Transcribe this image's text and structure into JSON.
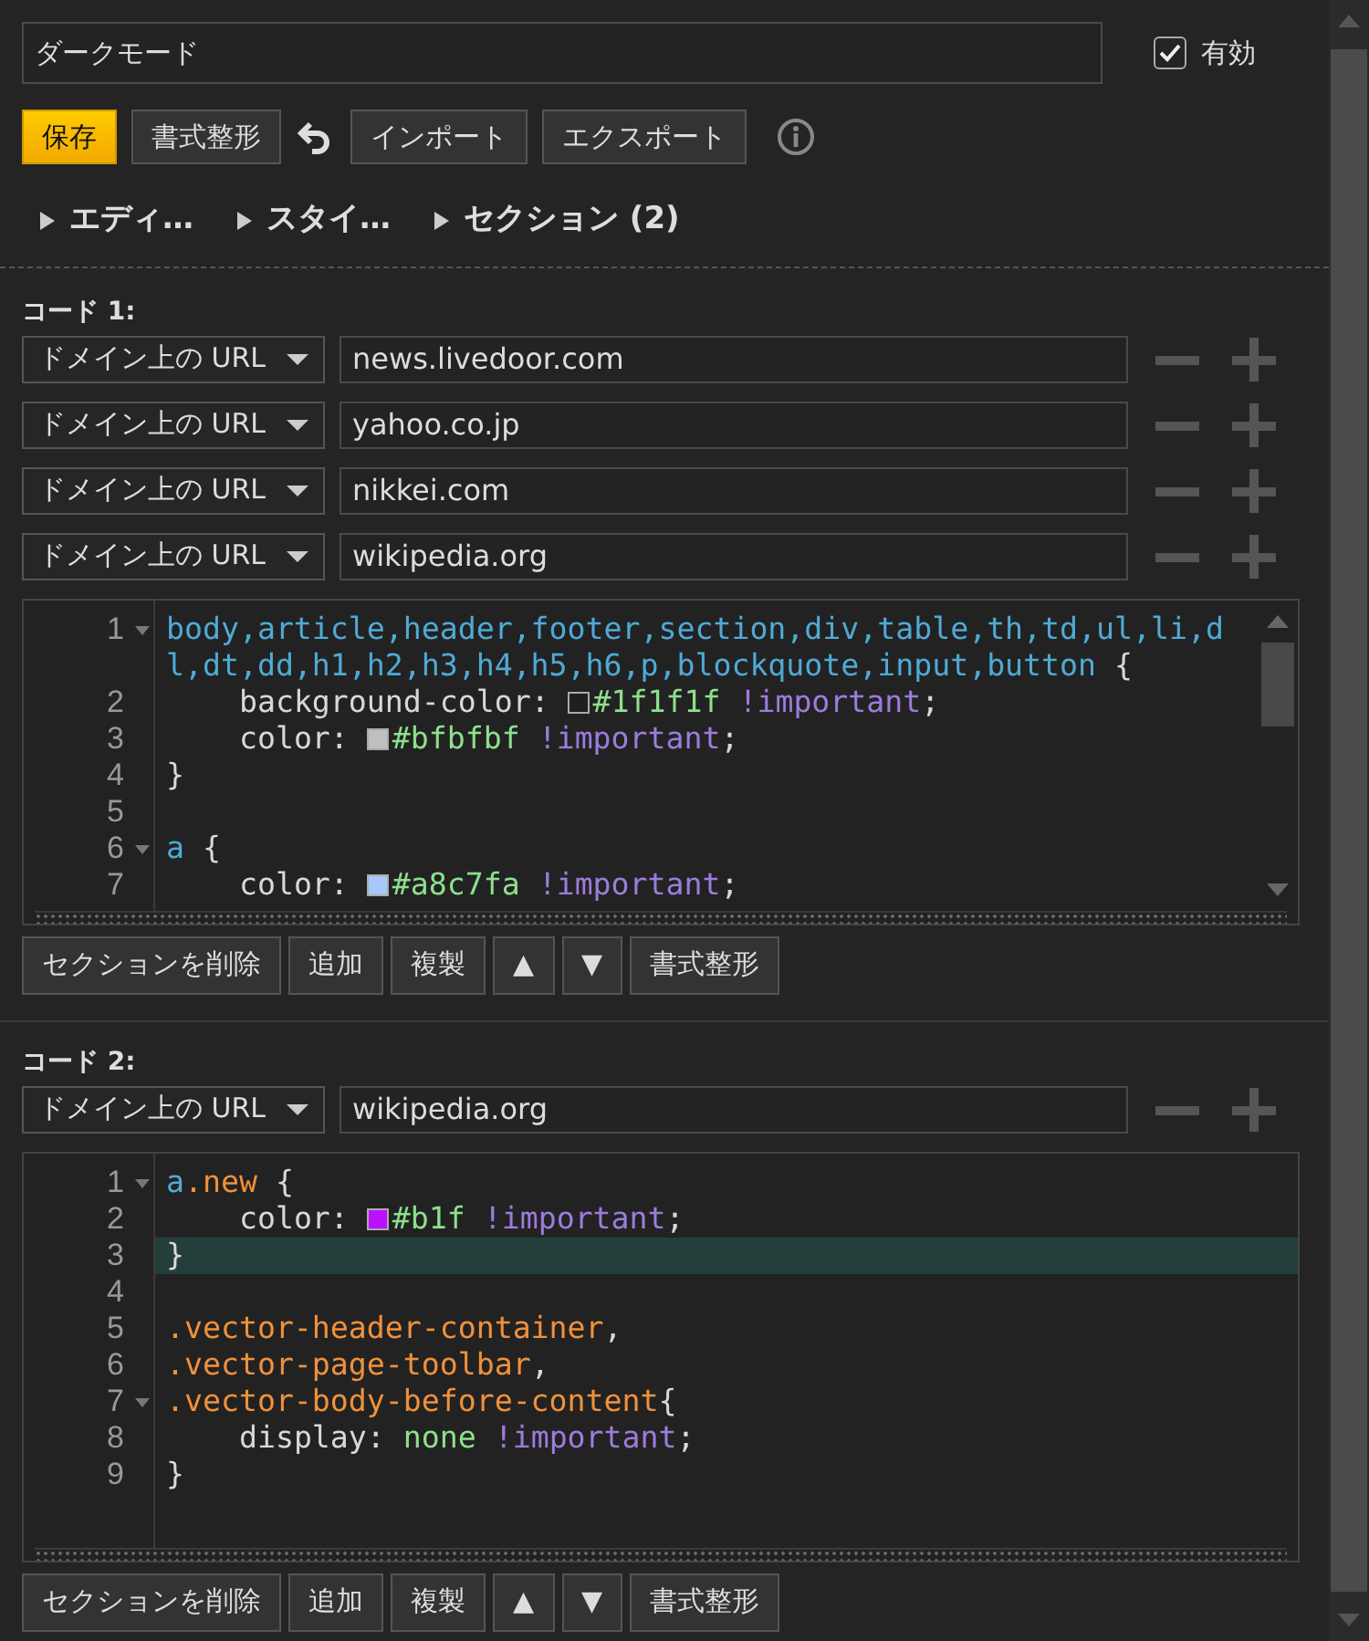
{
  "title_field": {
    "value": "ダークモード"
  },
  "enabled": {
    "label": "有効",
    "checked": true
  },
  "toolbar": [
    {
      "kind": "button",
      "label": "保存",
      "primary": true
    },
    {
      "kind": "button",
      "label": "書式整形",
      "primary": false
    },
    {
      "kind": "undo"
    },
    {
      "kind": "button",
      "label": "インポート",
      "primary": false
    },
    {
      "kind": "button",
      "label": "エクスポート",
      "primary": false
    },
    {
      "kind": "info"
    }
  ],
  "panels": [
    {
      "label": "エディ…",
      "expanded": false
    },
    {
      "label": "スタイ…",
      "expanded": false
    },
    {
      "label": "セクション (2)",
      "expanded": false
    }
  ],
  "sections": [
    {
      "heading": "コード 1:",
      "urls": [
        {
          "type": "ドメイン上の URL",
          "value": "news.livedoor.com"
        },
        {
          "type": "ドメイン上の URL",
          "value": "yahoo.co.jp"
        },
        {
          "type": "ドメイン上の URL",
          "value": "nikkei.com"
        },
        {
          "type": "ドメイン上の URL",
          "value": "wikipedia.org"
        }
      ],
      "scrollable": true,
      "code": [
        {
          "number": "1",
          "foldable": true,
          "active": false,
          "tokens": [
            {
              "text": "body,article,header,footer,section,div,table,th,td,ul,li,dl,dt,dd,h1,h2,h3,h4,h5,h6,p,blockquote,input,button",
              "kind": "sel"
            },
            {
              "text": " {",
              "kind": "plain"
            }
          ]
        },
        {
          "number": "2",
          "foldable": false,
          "active": false,
          "tokens": [
            {
              "text": "    background-color: ",
              "kind": "plain"
            },
            {
              "kind": "swatch",
              "color": "#1f1f1f"
            },
            {
              "text": "#1f1f1f",
              "kind": "val"
            },
            {
              "text": " !important",
              "kind": "imp"
            },
            {
              "text": ";",
              "kind": "plain"
            }
          ]
        },
        {
          "number": "3",
          "foldable": false,
          "active": false,
          "tokens": [
            {
              "text": "    color: ",
              "kind": "plain"
            },
            {
              "kind": "swatch",
              "color": "#bfbfbf"
            },
            {
              "text": "#bfbfbf",
              "kind": "val"
            },
            {
              "text": " !important",
              "kind": "imp"
            },
            {
              "text": ";",
              "kind": "plain"
            }
          ]
        },
        {
          "number": "4",
          "foldable": false,
          "active": false,
          "tokens": [
            {
              "text": "}",
              "kind": "plain"
            }
          ]
        },
        {
          "number": "5",
          "foldable": false,
          "active": false
        },
        {
          "number": "6",
          "foldable": true,
          "active": false,
          "tokens": [
            {
              "text": "a",
              "kind": "sel"
            },
            {
              "text": " {",
              "kind": "plain"
            }
          ]
        },
        {
          "number": "7",
          "foldable": false,
          "active": false,
          "tokens": [
            {
              "text": "    color: ",
              "kind": "plain"
            },
            {
              "kind": "swatch",
              "color": "#a8c7fa"
            },
            {
              "text": "#a8c7fa",
              "kind": "val"
            },
            {
              "text": " !important",
              "kind": "imp"
            },
            {
              "text": ";",
              "kind": "plain"
            }
          ]
        }
      ],
      "buttons": [
        "セクションを削除",
        "追加",
        "複製",
        "▲",
        "▼",
        "書式整形"
      ]
    },
    {
      "heading": "コード 2:",
      "urls": [
        {
          "type": "ドメイン上の URL",
          "value": "wikipedia.org"
        }
      ],
      "scrollable": false,
      "code": [
        {
          "number": "1",
          "foldable": true,
          "active": false,
          "tokens": [
            {
              "text": "a",
              "kind": "sel"
            },
            {
              "text": ".new",
              "kind": "cls"
            },
            {
              "text": " {",
              "kind": "plain"
            }
          ]
        },
        {
          "number": "2",
          "foldable": false,
          "active": false,
          "tokens": [
            {
              "text": "    color: ",
              "kind": "plain"
            },
            {
              "kind": "swatch",
              "color": "#bb11ff"
            },
            {
              "text": "#b1f",
              "kind": "val"
            },
            {
              "text": " !important",
              "kind": "imp"
            },
            {
              "text": ";",
              "kind": "plain"
            }
          ]
        },
        {
          "number": "3",
          "foldable": false,
          "active": true,
          "tokens": [
            {
              "text": "}",
              "kind": "plain"
            }
          ]
        },
        {
          "number": "4",
          "foldable": false,
          "active": false
        },
        {
          "number": "5",
          "foldable": false,
          "active": false,
          "tokens": [
            {
              "text": ".vector-header-container",
              "kind": "cls"
            },
            {
              "text": ",",
              "kind": "plain"
            }
          ]
        },
        {
          "number": "6",
          "foldable": false,
          "active": false,
          "tokens": [
            {
              "text": ".vector-page-toolbar",
              "kind": "cls"
            },
            {
              "text": ",",
              "kind": "plain"
            }
          ]
        },
        {
          "number": "7",
          "foldable": true,
          "active": false,
          "tokens": [
            {
              "text": ".vector-body-before-content",
              "kind": "cls"
            },
            {
              "text": "{",
              "kind": "plain"
            }
          ]
        },
        {
          "number": "8",
          "foldable": false,
          "active": false,
          "tokens": [
            {
              "text": "    display: ",
              "kind": "plain"
            },
            {
              "text": "none",
              "kind": "val"
            },
            {
              "text": " !important",
              "kind": "imp"
            },
            {
              "text": ";",
              "kind": "plain"
            }
          ]
        },
        {
          "number": "9",
          "foldable": false,
          "active": false,
          "tokens": [
            {
              "text": "}",
              "kind": "plain"
            }
          ]
        }
      ],
      "buttons": [
        "セクションを削除",
        "追加",
        "複製",
        "▲",
        "▼",
        "書式整形"
      ]
    }
  ]
}
